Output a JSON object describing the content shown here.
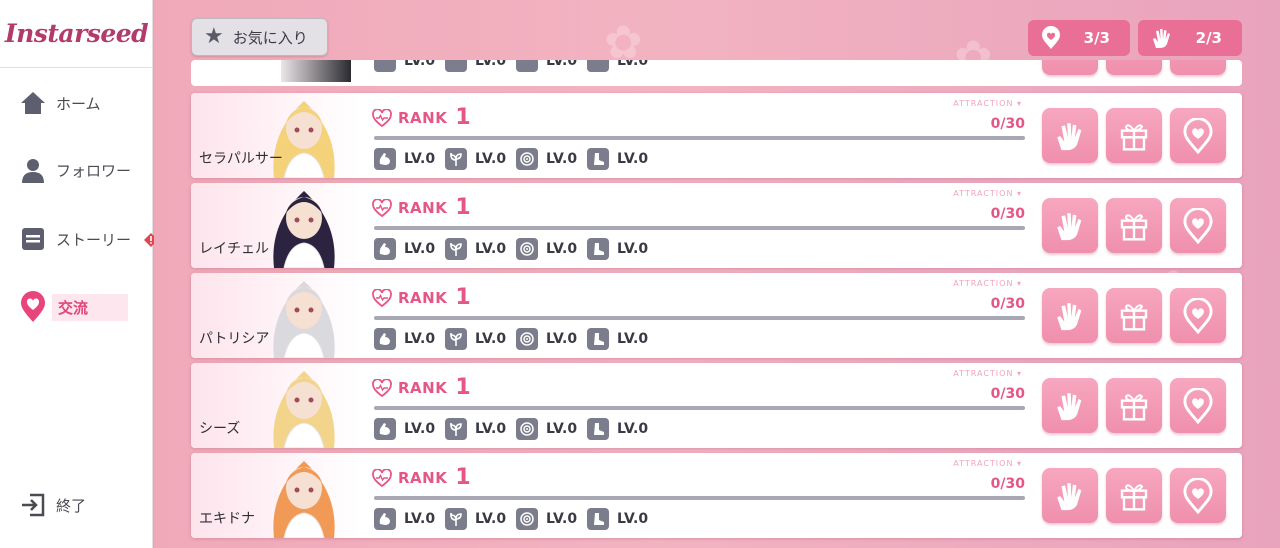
{
  "app": {
    "logo": "Instarseed"
  },
  "nav": {
    "home": "ホーム",
    "followers": "フォロワー",
    "story": "ストーリー",
    "exchange": "交流",
    "exit": "終了"
  },
  "header": {
    "favorites_label": "お気に入り",
    "location_count": "3/3",
    "hand_count": "2/3"
  },
  "accent_color": "#e55687",
  "cards": [
    {
      "name": "セラパルサー",
      "rank_label": "RANK",
      "rank": "1",
      "attraction_label": "ATTRACTION ▾",
      "attraction": "0/30",
      "stats": [
        "LV.0",
        "LV.0",
        "LV.0",
        "LV.0"
      ],
      "hair": "#f3d27a"
    },
    {
      "name": "レイチェル",
      "rank_label": "RANK",
      "rank": "1",
      "attraction_label": "ATTRACTION ▾",
      "attraction": "0/30",
      "stats": [
        "LV.0",
        "LV.0",
        "LV.0",
        "LV.0"
      ],
      "hair": "#2b2340"
    },
    {
      "name": "パトリシア",
      "rank_label": "RANK",
      "rank": "1",
      "attraction_label": "ATTRACTION ▾",
      "attraction": "0/30",
      "stats": [
        "LV.0",
        "LV.0",
        "LV.0",
        "LV.0"
      ],
      "hair": "#d9d9de"
    },
    {
      "name": "シーズ",
      "rank_label": "RANK",
      "rank": "1",
      "attraction_label": "ATTRACTION ▾",
      "attraction": "0/30",
      "stats": [
        "LV.0",
        "LV.0",
        "LV.0",
        "LV.0"
      ],
      "hair": "#f2d48a"
    },
    {
      "name": "エキドナ",
      "rank_label": "RANK",
      "rank": "1",
      "attraction_label": "ATTRACTION ▾",
      "attraction": "0/30",
      "stats": [
        "LV.0",
        "LV.0",
        "LV.0",
        "LV.0"
      ],
      "hair": "#f09a55"
    }
  ],
  "partial_card": {
    "stats": [
      "LV.0",
      "LV.0",
      "LV.0",
      "LV.0"
    ]
  }
}
